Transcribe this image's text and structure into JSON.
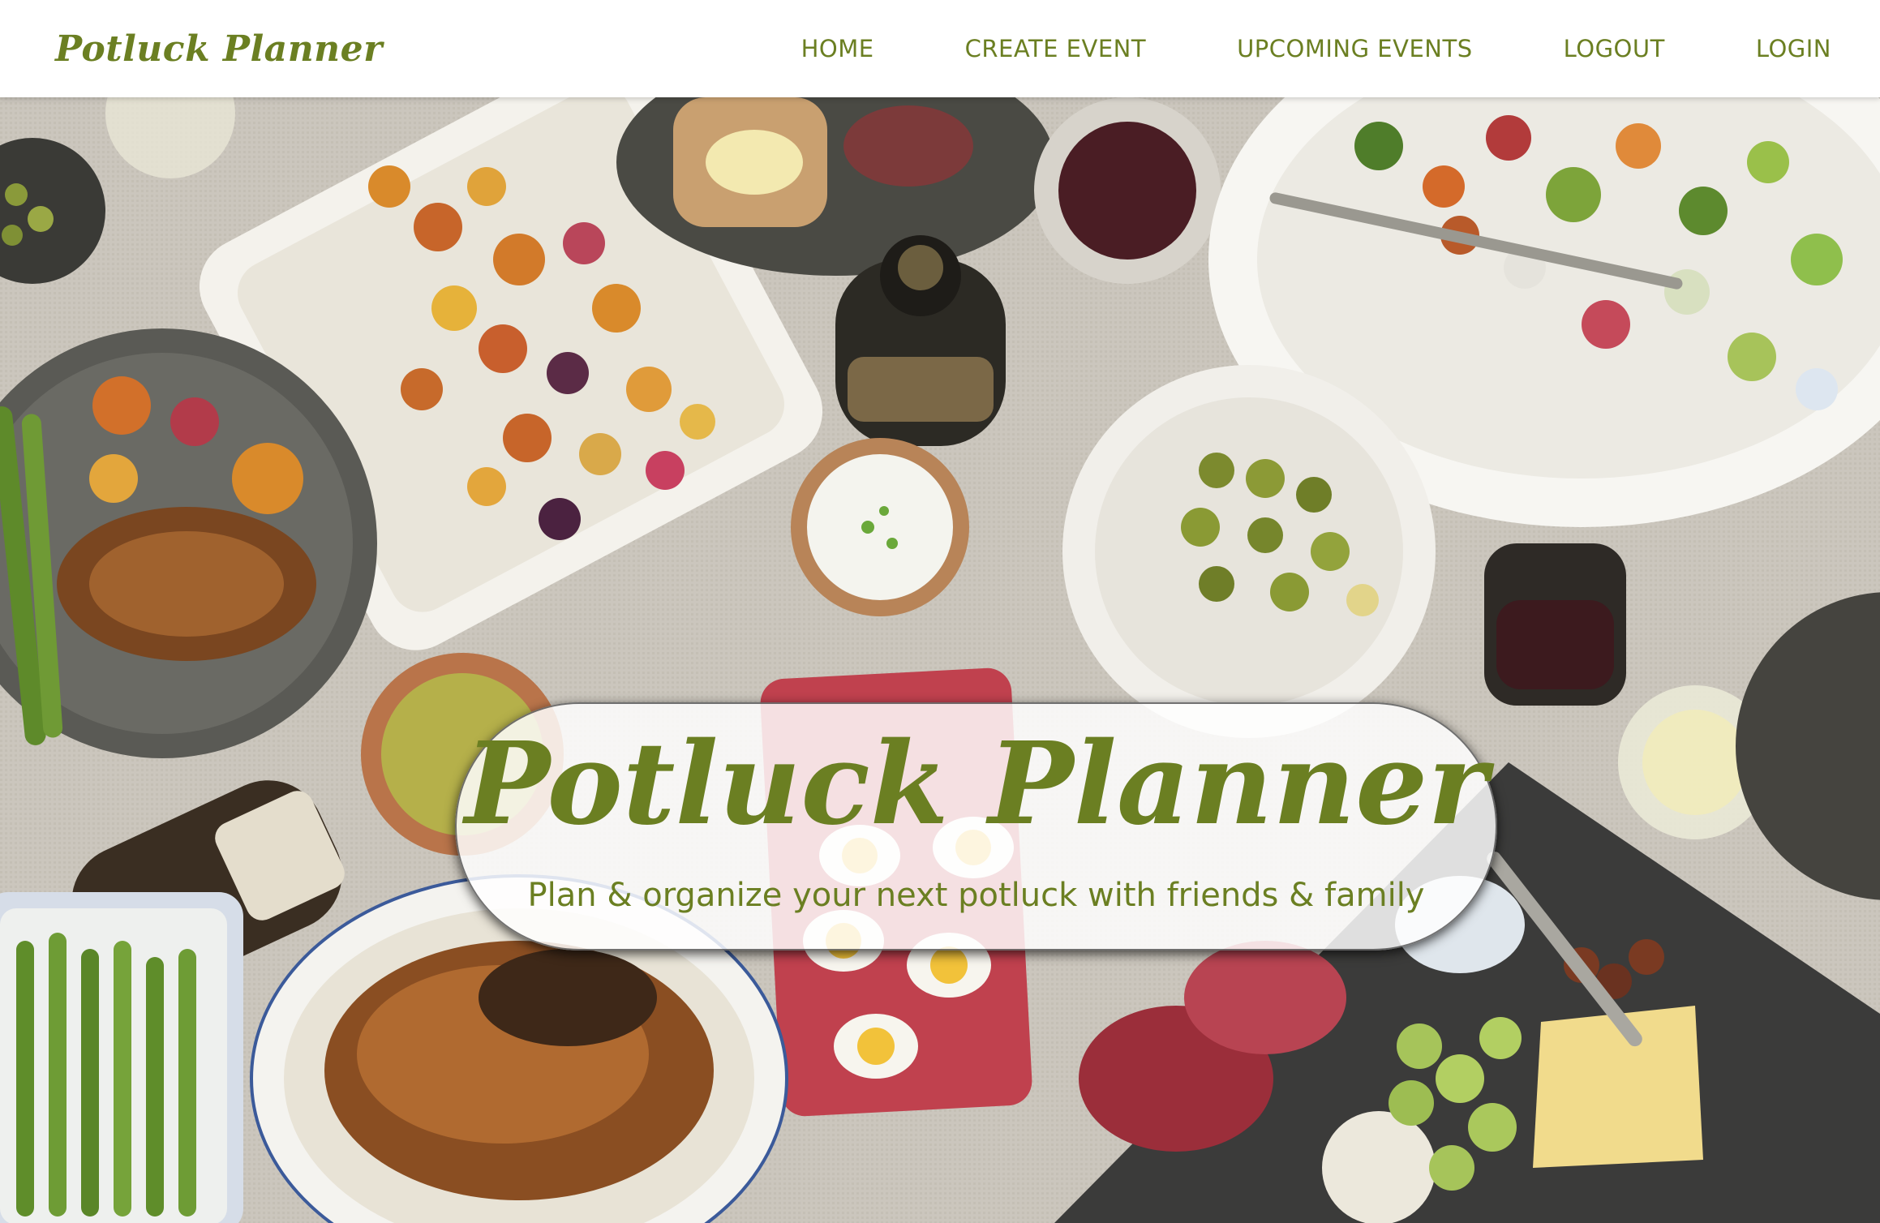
{
  "header": {
    "brand": "Potluck Planner",
    "nav": [
      {
        "label": "HOME"
      },
      {
        "label": "CREATE EVENT"
      },
      {
        "label": "UPCOMING EVENTS"
      },
      {
        "label": "LOGOUT"
      },
      {
        "label": "LOGIN"
      }
    ]
  },
  "hero": {
    "title": "Potluck Planner",
    "subtitle": "Plan & organize your next potluck with friends & family"
  },
  "colors": {
    "accent": "#6b7f22",
    "navbar_bg": "#ffffff",
    "tablecloth": "#cbc6bd"
  }
}
